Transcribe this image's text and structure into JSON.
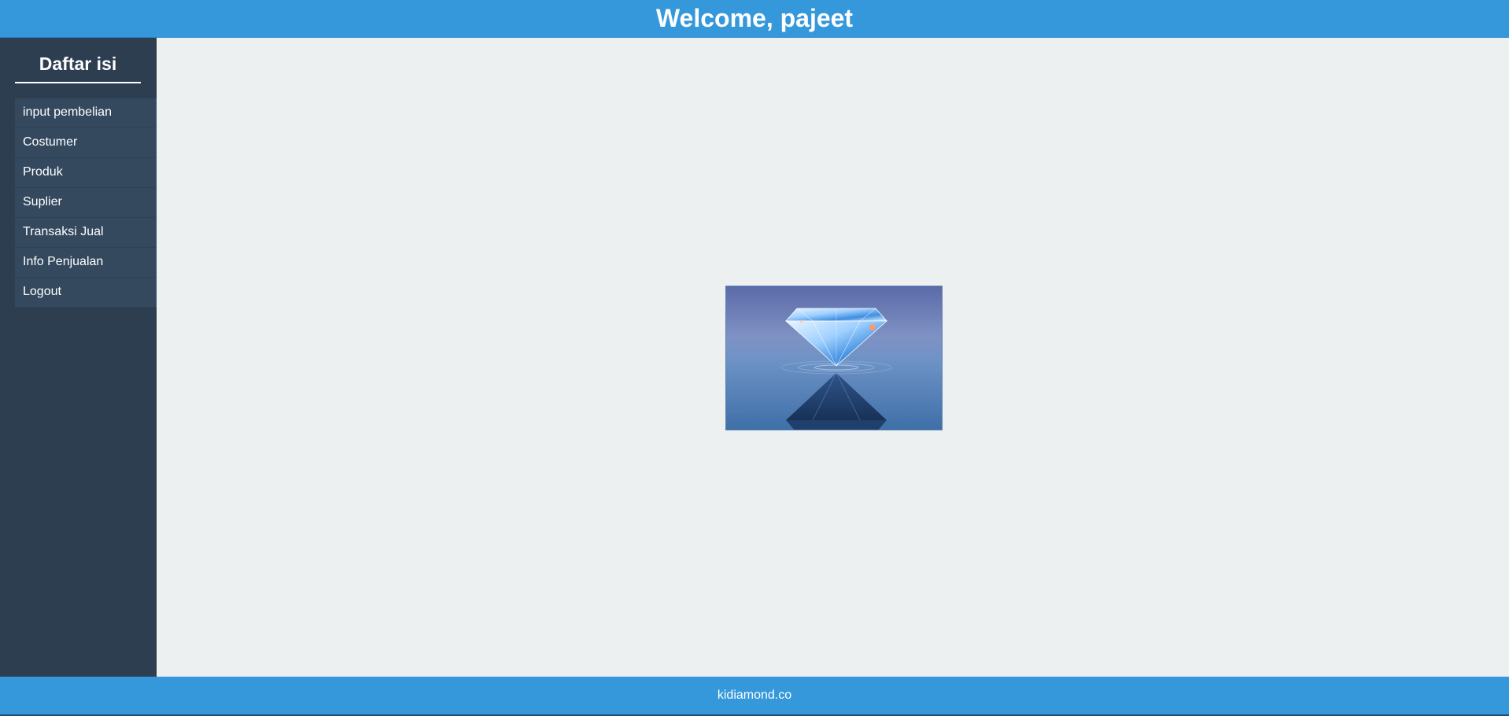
{
  "header": {
    "title": "Welcome, pajeet"
  },
  "sidebar": {
    "title": "Daftar isi",
    "items": [
      {
        "label": "input pembelian"
      },
      {
        "label": "Costumer"
      },
      {
        "label": "Produk"
      },
      {
        "label": "Suplier"
      },
      {
        "label": "Transaksi Jual"
      },
      {
        "label": "Info Penjualan"
      },
      {
        "label": "Logout"
      }
    ]
  },
  "main": {
    "image": {
      "icon": "diamond-image"
    }
  },
  "footer": {
    "text": "kidiamond.co"
  },
  "colors": {
    "header_bg": "#3498db",
    "sidebar_bg": "#2c3e50",
    "menu_item_bg": "#34495e",
    "content_bg": "#ecf0f1"
  }
}
